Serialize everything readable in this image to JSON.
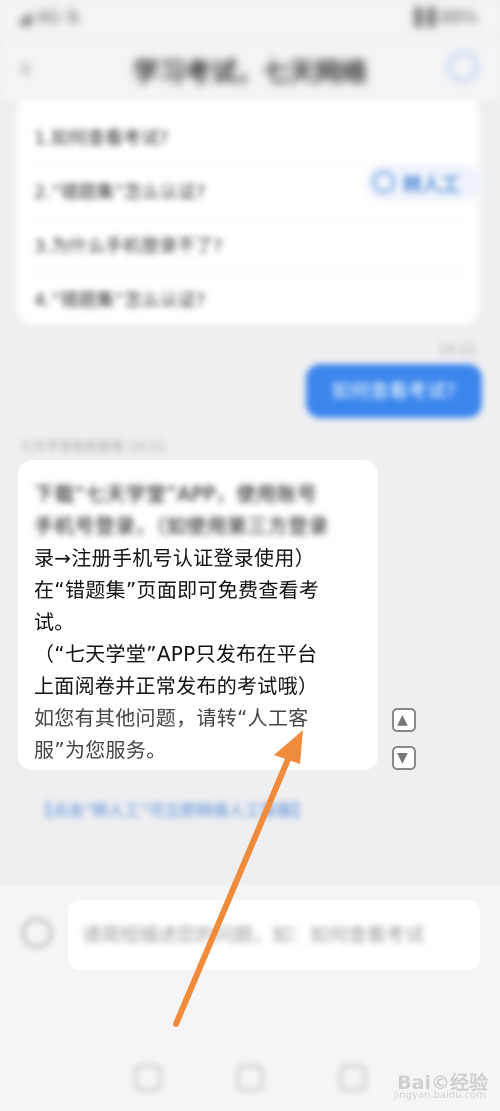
{
  "status_bar": {
    "left": "◢ 4G ⇅",
    "right": "▐▐ 88%"
  },
  "header": {
    "title": "学习考试，七天网络"
  },
  "faq": {
    "items": [
      "1.如何查看考试?",
      "2.“错题集”怎么认证?",
      "3.为什么手机登录不了?",
      "4.“错题集”怎么认证?"
    ],
    "transfer_label": "转人工"
  },
  "user_message": {
    "time": "10:21",
    "text": "如何查看考试?"
  },
  "bot_answer": {
    "meta": "七天学堂智能客服  10:21",
    "lines": [
      "下载“七天学堂”APP，使用账号",
      "手机号登录，（如使用第三方登录",
      "录→注册手机号认证登录使用）",
      "在“错题集”页面即可免费查看考",
      "试。",
      "（“七天学堂”APP只发布在平台",
      "上面阅卷并正常发布的考试哦）",
      "如您有其他问题，请转“人工客",
      "服”为您服务。"
    ],
    "escalate_link": "【点击“转人工”可立即转接人工客服】"
  },
  "input": {
    "placeholder": "请简短描述您的问题，如：如何查看考试"
  },
  "annotation": {
    "arrow_color": "#f08b3c"
  },
  "watermark": {
    "text": "Bai©经验",
    "sub": "jingyan.baidu.com"
  }
}
